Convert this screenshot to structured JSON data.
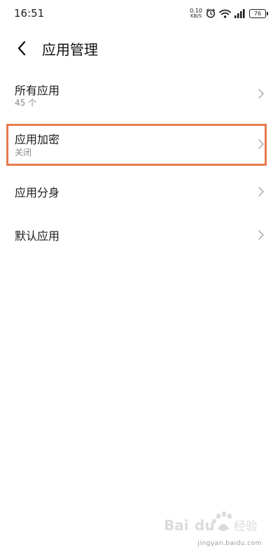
{
  "status_bar": {
    "time": "16:51",
    "net_speed_value": "0.10",
    "net_speed_unit": "KB/S",
    "battery_level": "76",
    "icons": [
      "alarm-icon",
      "wifi-icon",
      "signal-icon",
      "battery-icon"
    ]
  },
  "header": {
    "back_icon": "chevron-left-icon",
    "title": "应用管理"
  },
  "menu": {
    "items": [
      {
        "title": "所有应用",
        "subtitle": "45 个"
      },
      {
        "title": "应用加密",
        "subtitle": "关闭"
      },
      {
        "title": "应用分身"
      },
      {
        "title": "默认应用"
      }
    ]
  },
  "annotation": {
    "highlight_color": "#e77b4e"
  },
  "watermark": {
    "brand": "Baidu 经验",
    "url": "jingyan.baidu.com"
  },
  "colors": {
    "background": "#ffffff",
    "text_primary": "#1a1a1a",
    "text_secondary": "#8a8a8a",
    "chevron": "#b5b5b5"
  }
}
